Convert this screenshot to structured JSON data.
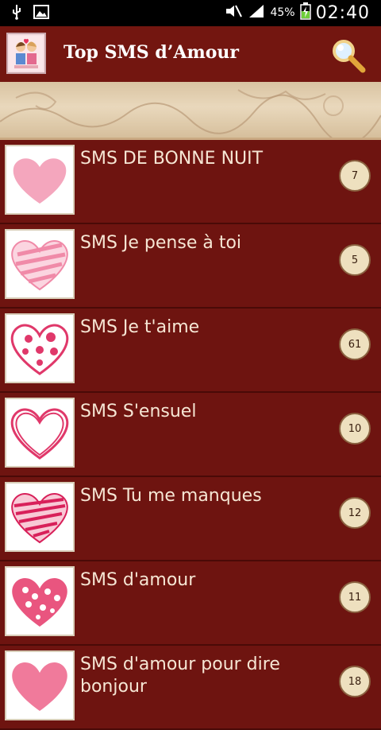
{
  "status_bar": {
    "battery_percent": "45%",
    "time": "02:40"
  },
  "app_bar": {
    "title": "Top SMS d’Amour"
  },
  "categories": [
    {
      "label": "SMS DE BONNE NUIT",
      "count": "7"
    },
    {
      "label": "SMS Je pense à toi",
      "count": "5"
    },
    {
      "label": "SMS Je t'aime",
      "count": "61"
    },
    {
      "label": "SMS S'ensuel",
      "count": "10"
    },
    {
      "label": "SMS Tu me manques",
      "count": "12"
    },
    {
      "label": "SMS d'amour",
      "count": "11"
    },
    {
      "label": "SMS d'amour pour dire bonjour",
      "count": "18"
    }
  ],
  "colors": {
    "app_bar": "#731610",
    "list_background": "#6e1410",
    "badge_background": "#eee0bf",
    "heart_pink": "#f4a6bd",
    "heart_magenta": "#e0386a"
  }
}
